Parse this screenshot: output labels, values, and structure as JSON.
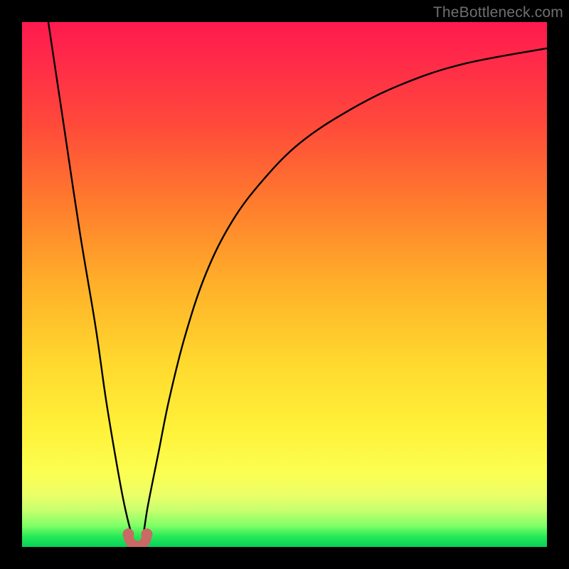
{
  "watermark": "TheBottleneck.com",
  "chart_data": {
    "type": "line",
    "title": "",
    "xlabel": "",
    "ylabel": "",
    "xlim": [
      0,
      100
    ],
    "ylim": [
      0,
      100
    ],
    "grid": false,
    "legend": false,
    "series": [
      {
        "name": "bottleneck-curve",
        "x": [
          5,
          8,
          11,
          14,
          16,
          18,
          19.5,
          21,
          22,
          23,
          24,
          26,
          28,
          31,
          35,
          40,
          46,
          53,
          62,
          72,
          84,
          100
        ],
        "y": [
          100,
          80,
          60,
          42,
          28,
          16,
          8,
          2,
          0,
          2,
          8,
          18,
          28,
          40,
          52,
          62,
          70,
          77,
          83,
          88,
          92,
          95
        ]
      }
    ],
    "markers": [
      {
        "name": "min-marker",
        "x": 22,
        "y": 0
      }
    ],
    "colors": {
      "curve": "#000000",
      "marker": "#c96a64",
      "gradient_top": "#ff1a4f",
      "gradient_bottom": "#07d15a"
    }
  }
}
